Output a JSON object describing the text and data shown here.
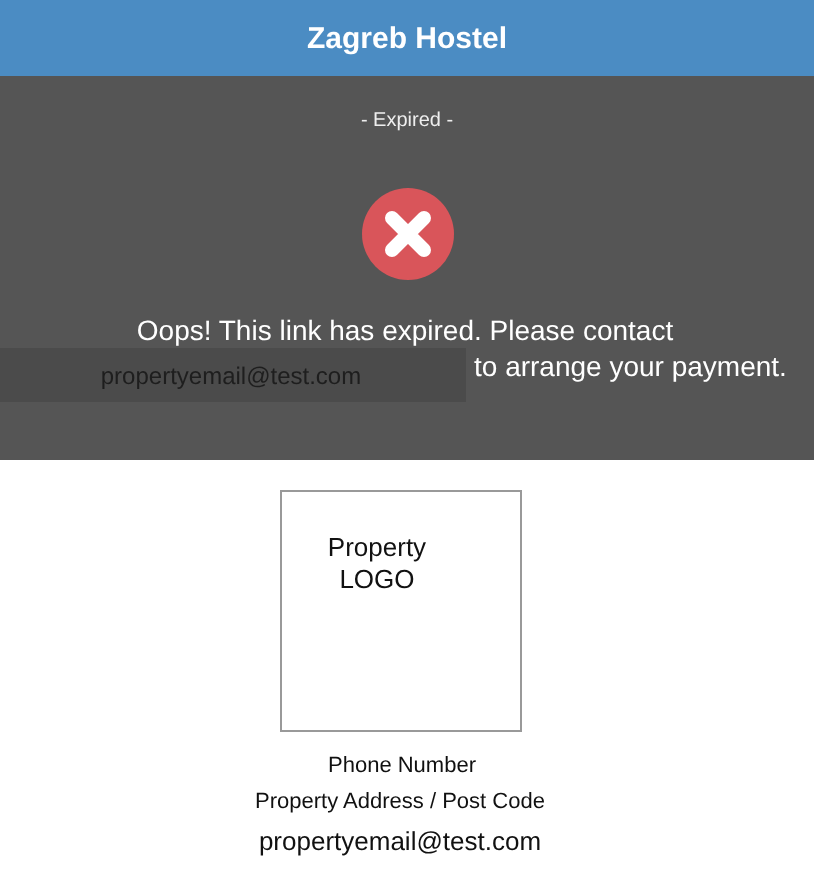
{
  "header": {
    "title": "Zagreb Hostel"
  },
  "status": {
    "label": "- Expired -",
    "kind": "error",
    "message": "Oops! This link has expired. Please contact",
    "email": "propertyemail@test.com",
    "message_end": "to arrange your payment."
  },
  "property": {
    "logo_lines": [
      "Property",
      "LOGO"
    ],
    "phone": "Phone Number",
    "address": "Property Address / Post Code",
    "email": "propertyemail@test.com"
  }
}
